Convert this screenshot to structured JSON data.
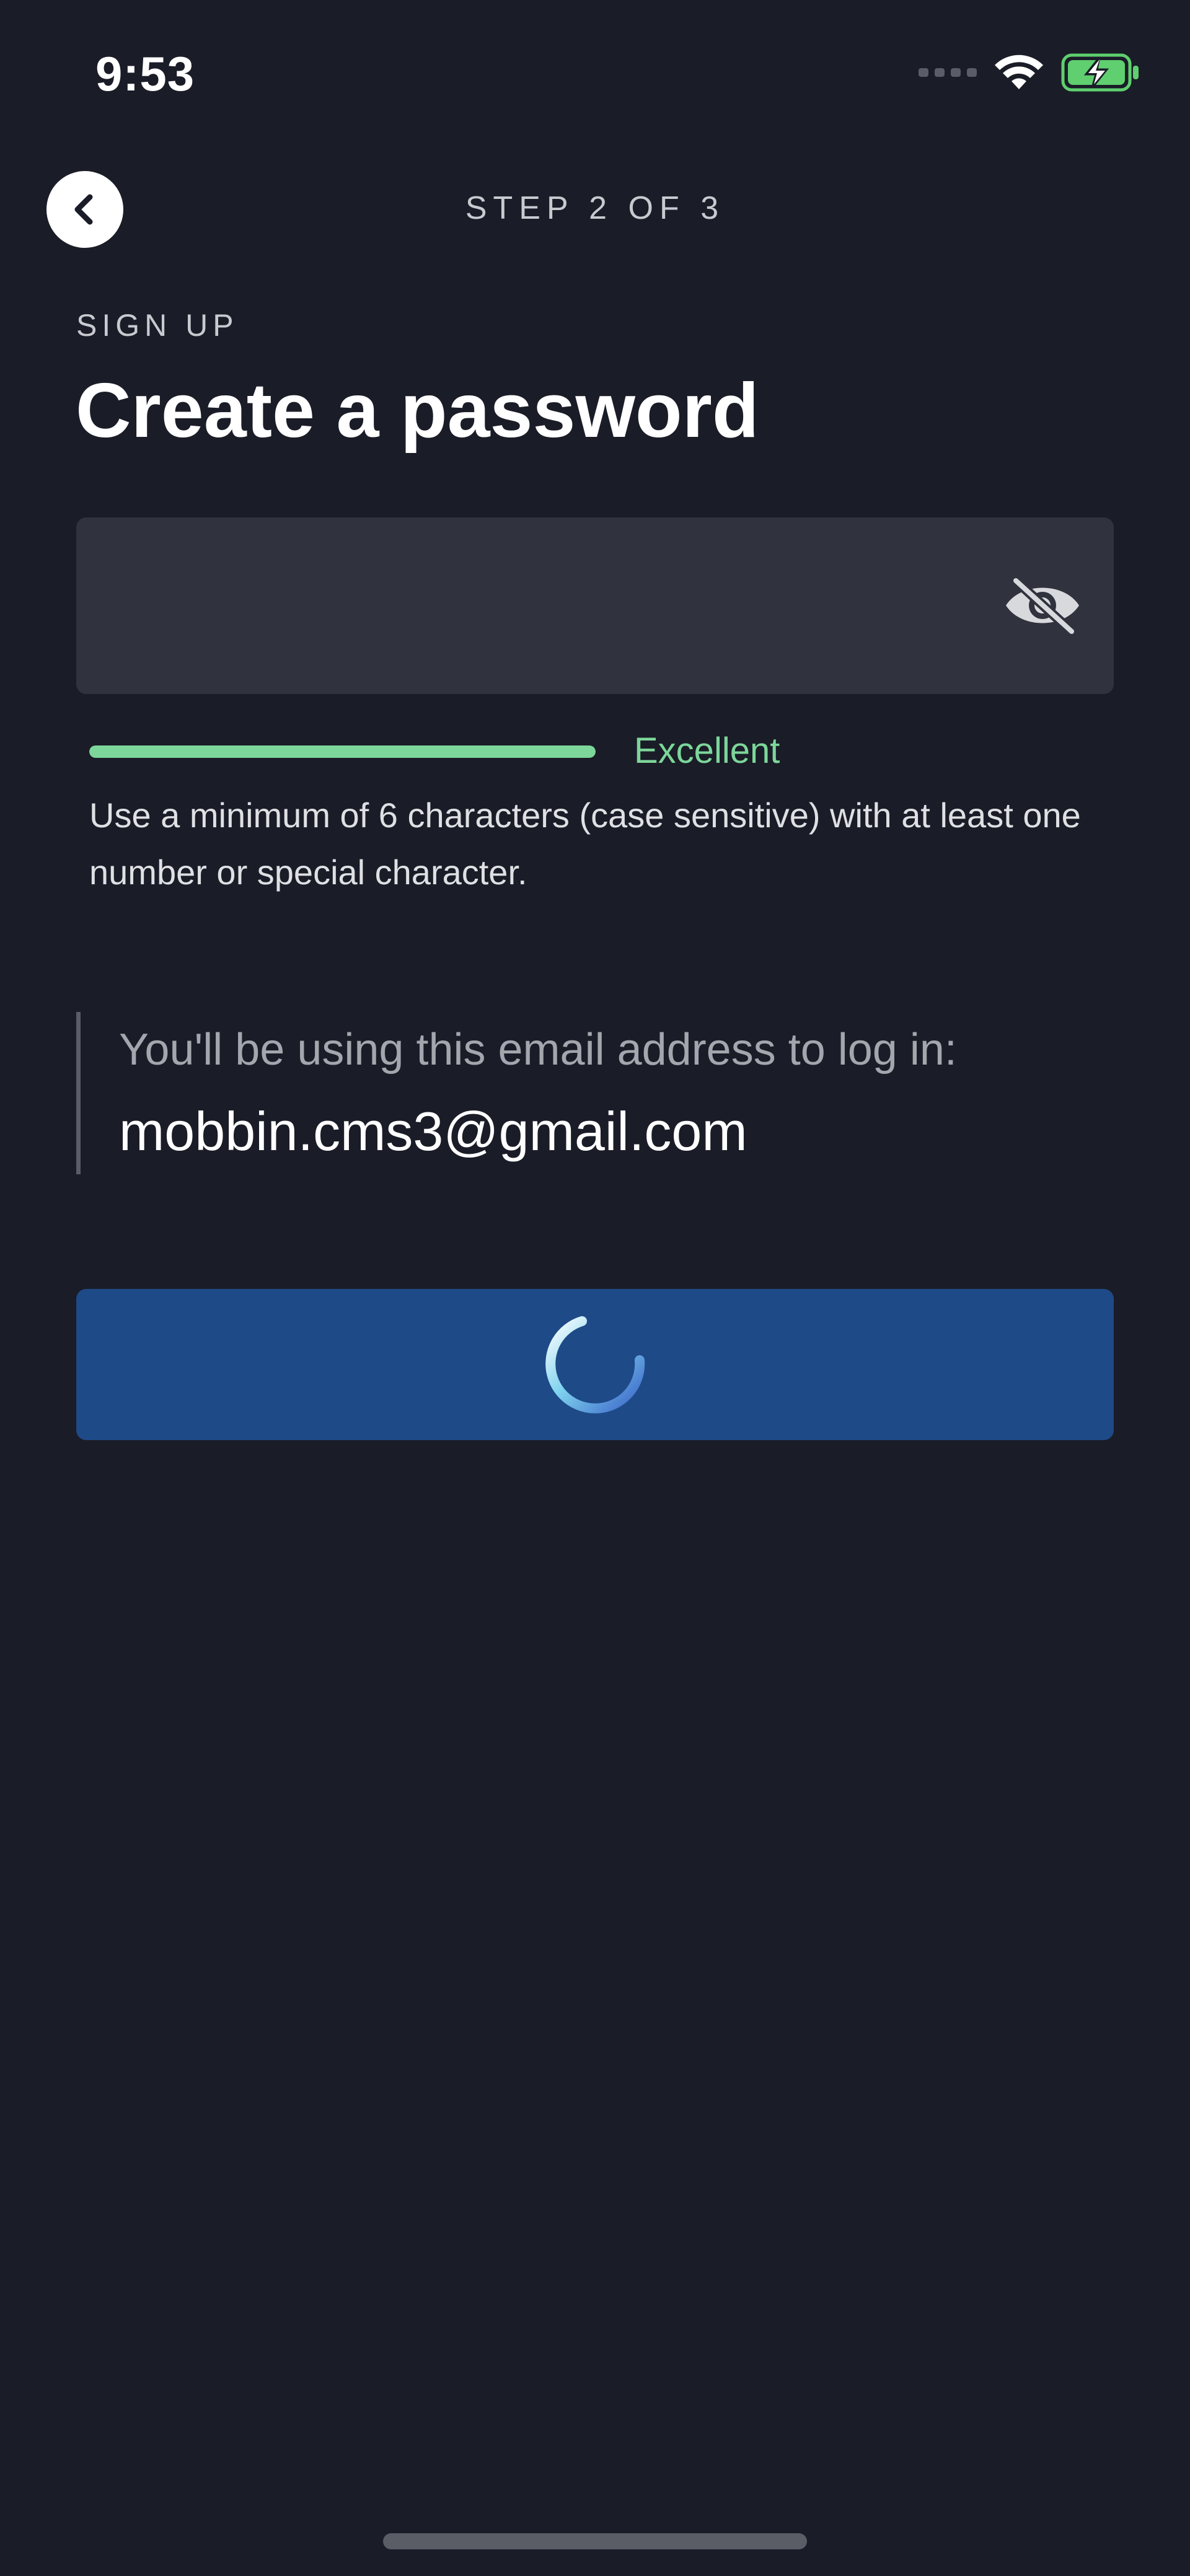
{
  "status_bar": {
    "time": "9:53",
    "battery_color": "#5fcf6f"
  },
  "header": {
    "step_label": "STEP 2 OF 3",
    "back_icon": "chevron-left-icon"
  },
  "form": {
    "eyebrow": "SIGN UP",
    "title": "Create a password",
    "password_value": "",
    "visibility_icon": "eye-slash-icon",
    "strength": {
      "label": "Excellent",
      "level": 1.0,
      "color": "#7dd69a"
    },
    "hint": "Use a minimum of 6 characters (case sensitive) with at least one number or special character."
  },
  "email_notice": {
    "caption": "You'll be using this email address to log in:",
    "email": "mobbin.cms3@gmail.com"
  },
  "continue_button": {
    "state": "loading",
    "spinner_icon": "loading-spinner-icon",
    "background": "#1e4a87"
  },
  "colors": {
    "background": "#1a1c27",
    "field_background": "#30323d",
    "accent_green": "#7dd69a"
  }
}
